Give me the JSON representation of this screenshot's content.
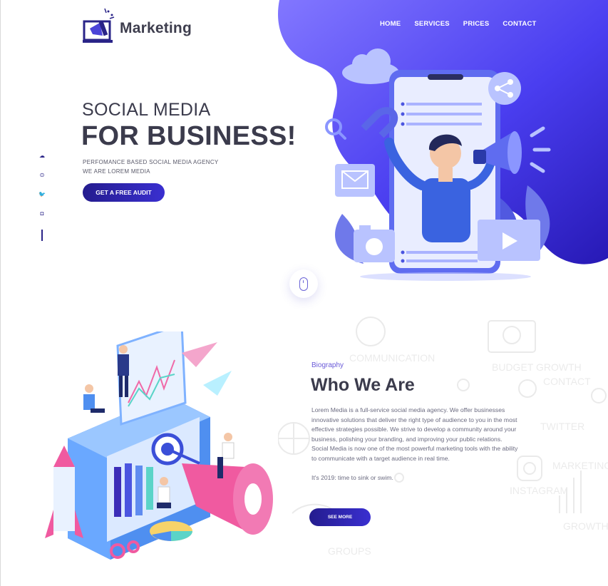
{
  "brand": {
    "name": "Marketing"
  },
  "nav": {
    "items": [
      "HOME",
      "SERVICES",
      "PRICES",
      "CONTACT"
    ]
  },
  "hero": {
    "kicker": "SOCIAL MEDIA",
    "title": "FOR BUSINESS!",
    "subtitle_line1": "PERFOMANCE BASED SOCIAL MEDIA AGENCY",
    "subtitle_line2": "WE ARE LOREM MEDIA",
    "cta_label": "GET A FREE AUDIT"
  },
  "social": {
    "icons": [
      "cloud-icon",
      "pinterest-icon",
      "twitter-icon",
      "instagram-icon"
    ]
  },
  "about": {
    "eyebrow": "Biography",
    "title": "Who We Are",
    "paragraph1": "Lorem Media is a full-service social media agency. We offer businesses innovative solutions that deliver the right type of audience to you in the most effective strategies possible. We strive to develop a community around your business, polishing your branding, and improving your public relations.",
    "paragraph2": "Social Media is now one of the most powerful marketing tools with the ability to communicate with a target audience in real time.",
    "paragraph3": "It's 2019: time to sink or swim.",
    "cta_label": "SEE MORE",
    "doodle_words": [
      "COMMUNICATION",
      "CONTACT",
      "TWITTER",
      "MARKETING",
      "INSTAGRAM",
      "GROWTH",
      "GROUPS",
      "BUDGET GROWTH"
    ]
  },
  "colors": {
    "accent": "#3a2fd0",
    "blob_top": "#7a6cff",
    "blob_bottom": "#2a1fb8",
    "text": "#3b3b4c"
  }
}
